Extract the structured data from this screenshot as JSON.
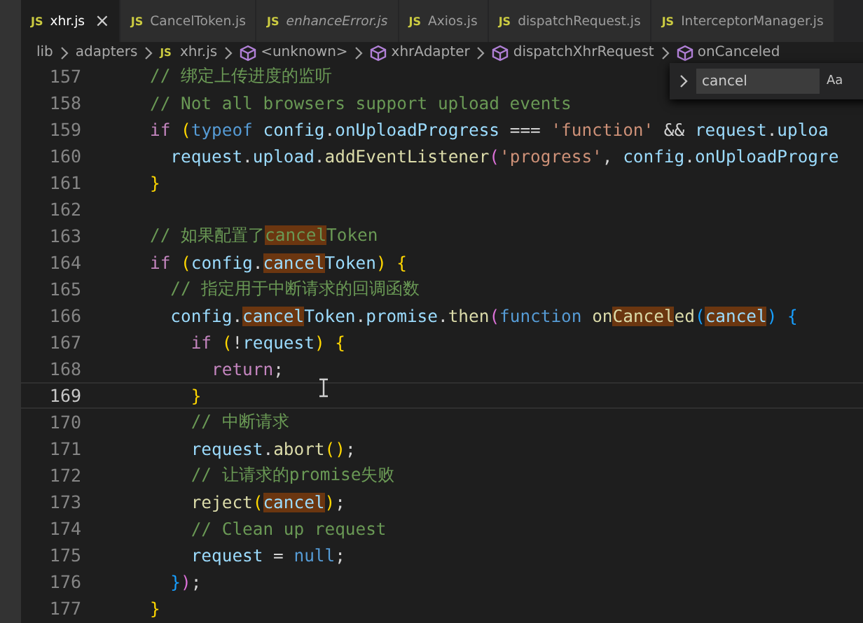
{
  "tabs": [
    {
      "icon_text": "JS",
      "label": "xhr.js",
      "selected": true,
      "preview": false,
      "close": "×"
    },
    {
      "icon_text": "JS",
      "label": "CancelToken.js",
      "selected": false,
      "preview": false
    },
    {
      "icon_text": "JS",
      "label": "enhanceError.js",
      "selected": false,
      "preview": true
    },
    {
      "icon_text": "JS",
      "label": "Axios.js",
      "selected": false,
      "preview": false
    },
    {
      "icon_text": "JS",
      "label": "dispatchRequest.js",
      "selected": false,
      "preview": false
    },
    {
      "icon_text": "JS",
      "label": "InterceptorManager.js",
      "selected": false,
      "preview": false
    }
  ],
  "breadcrumbs": [
    {
      "kind": "folder",
      "label": "lib"
    },
    {
      "kind": "folder",
      "label": "adapters"
    },
    {
      "kind": "file",
      "icon_text": "JS",
      "label": "xhr.js"
    },
    {
      "kind": "symbol",
      "label": "<unknown>"
    },
    {
      "kind": "symbol",
      "label": "xhrAdapter"
    },
    {
      "kind": "symbol",
      "label": "dispatchXhrRequest"
    },
    {
      "kind": "symbol",
      "label": "onCanceled"
    }
  ],
  "find_widget": {
    "value": "cancel",
    "case_toggle": "Aa"
  },
  "lines": [
    {
      "number": "157",
      "current": false,
      "tokens": [
        {
          "text": "// 绑定上传进度的监听",
          "kind": "comment",
          "match": false
        }
      ]
    },
    {
      "number": "158",
      "current": false,
      "tokens": [
        {
          "text": "// Not all browsers support upload events",
          "kind": "comment",
          "match": false
        }
      ]
    },
    {
      "number": "159",
      "current": false,
      "tokens": [
        {
          "text": "if ",
          "kind": "keyword",
          "match": false
        },
        {
          "text": "(",
          "kind": "bracket1",
          "match": false
        },
        {
          "text": "typeof ",
          "kind": "storage",
          "match": false
        },
        {
          "text": "config",
          "kind": "variable",
          "match": false
        },
        {
          "text": ".",
          "kind": "plain",
          "match": false
        },
        {
          "text": "onUploadProgress",
          "kind": "variable",
          "match": false
        },
        {
          "text": " === ",
          "kind": "plain",
          "match": false
        },
        {
          "text": "'function'",
          "kind": "string",
          "match": false
        },
        {
          "text": " && ",
          "kind": "plain",
          "match": false
        },
        {
          "text": "request",
          "kind": "variable",
          "match": false
        },
        {
          "text": ".",
          "kind": "plain",
          "match": false
        },
        {
          "text": "uploa",
          "kind": "variable",
          "match": false
        }
      ]
    },
    {
      "number": "160",
      "current": false,
      "tokens": [
        {
          "text": "  request",
          "kind": "variable",
          "match": false
        },
        {
          "text": ".",
          "kind": "plain",
          "match": false
        },
        {
          "text": "upload",
          "kind": "variable",
          "match": false
        },
        {
          "text": ".",
          "kind": "plain",
          "match": false
        },
        {
          "text": "addEventListener",
          "kind": "function",
          "match": false
        },
        {
          "text": "(",
          "kind": "bracket2",
          "match": false
        },
        {
          "text": "'progress'",
          "kind": "string",
          "match": false
        },
        {
          "text": ", ",
          "kind": "plain",
          "match": false
        },
        {
          "text": "config",
          "kind": "variable",
          "match": false
        },
        {
          "text": ".",
          "kind": "plain",
          "match": false
        },
        {
          "text": "onUploadProgre",
          "kind": "variable",
          "match": false
        }
      ]
    },
    {
      "number": "161",
      "current": false,
      "tokens": [
        {
          "text": "}",
          "kind": "bracket1",
          "match": false
        }
      ]
    },
    {
      "number": "162",
      "current": false
    },
    {
      "number": "163",
      "current": false,
      "tokens": [
        {
          "text": "// 如果配置了",
          "kind": "comment",
          "match": false
        },
        {
          "text": "cancel",
          "kind": "comment",
          "match": true
        },
        {
          "text": "Token",
          "kind": "comment",
          "match": false
        }
      ]
    },
    {
      "number": "164",
      "current": false,
      "tokens": [
        {
          "text": "if ",
          "kind": "keyword",
          "match": false
        },
        {
          "text": "(",
          "kind": "bracket1",
          "match": false
        },
        {
          "text": "config",
          "kind": "variable",
          "match": false
        },
        {
          "text": ".",
          "kind": "plain",
          "match": false
        },
        {
          "text": "cancel",
          "kind": "variable",
          "match": true
        },
        {
          "text": "Token",
          "kind": "variable",
          "match": false
        },
        {
          "text": ") {",
          "kind": "bracket1",
          "match": false
        }
      ]
    },
    {
      "number": "165",
      "current": false,
      "tokens": [
        {
          "text": "  // 指定用于中断请求的回调函数",
          "kind": "comment",
          "match": false
        }
      ]
    },
    {
      "number": "166",
      "current": false,
      "tokens": [
        {
          "text": "  config",
          "kind": "variable",
          "match": false
        },
        {
          "text": ".",
          "kind": "plain",
          "match": false
        },
        {
          "text": "cancel",
          "kind": "variable",
          "match": true
        },
        {
          "text": "Token",
          "kind": "variable",
          "match": false
        },
        {
          "text": ".",
          "kind": "plain",
          "match": false
        },
        {
          "text": "promise",
          "kind": "variable",
          "match": false
        },
        {
          "text": ".",
          "kind": "plain",
          "match": false
        },
        {
          "text": "then",
          "kind": "function",
          "match": false
        },
        {
          "text": "(",
          "kind": "bracket2",
          "match": false
        },
        {
          "text": "function ",
          "kind": "storage",
          "match": false
        },
        {
          "text": "on",
          "kind": "function",
          "match": false
        },
        {
          "text": "Cancel",
          "kind": "function",
          "match": true
        },
        {
          "text": "ed",
          "kind": "function",
          "match": false
        },
        {
          "text": "(",
          "kind": "bracket3",
          "match": false
        },
        {
          "text": "cancel",
          "kind": "variable",
          "match": true
        },
        {
          "text": ") {",
          "kind": "bracket3",
          "match": false
        }
      ]
    },
    {
      "number": "167",
      "current": false,
      "tokens": [
        {
          "text": "    if ",
          "kind": "keyword",
          "match": false
        },
        {
          "text": "(",
          "kind": "bracket1",
          "match": false
        },
        {
          "text": "!",
          "kind": "plain",
          "match": false
        },
        {
          "text": "request",
          "kind": "variable",
          "match": false
        },
        {
          "text": ") {",
          "kind": "bracket1",
          "match": false
        }
      ]
    },
    {
      "number": "168",
      "current": false,
      "tokens": [
        {
          "text": "      return",
          "kind": "keyword",
          "match": false
        },
        {
          "text": ";",
          "kind": "plain",
          "match": false
        }
      ]
    },
    {
      "number": "169",
      "current": true,
      "tokens": [
        {
          "text": "    }",
          "kind": "bracket1",
          "match": false
        }
      ]
    },
    {
      "number": "170",
      "current": false,
      "tokens": [
        {
          "text": "    // 中断请求",
          "kind": "comment",
          "match": false
        }
      ]
    },
    {
      "number": "171",
      "current": false,
      "tokens": [
        {
          "text": "    request",
          "kind": "variable",
          "match": false
        },
        {
          "text": ".",
          "kind": "plain",
          "match": false
        },
        {
          "text": "abort",
          "kind": "function",
          "match": false
        },
        {
          "text": "()",
          "kind": "bracket1",
          "match": false
        },
        {
          "text": ";",
          "kind": "plain",
          "match": false
        }
      ]
    },
    {
      "number": "172",
      "current": false,
      "tokens": [
        {
          "text": "    // 让请求的promise失败",
          "kind": "comment",
          "match": false
        }
      ]
    },
    {
      "number": "173",
      "current": false,
      "tokens": [
        {
          "text": "    reject",
          "kind": "function",
          "match": false
        },
        {
          "text": "(",
          "kind": "bracket1",
          "match": false
        },
        {
          "text": "cancel",
          "kind": "variable",
          "match": true
        },
        {
          "text": ")",
          "kind": "bracket1",
          "match": false
        },
        {
          "text": ";",
          "kind": "plain",
          "match": false
        }
      ]
    },
    {
      "number": "174",
      "current": false,
      "tokens": [
        {
          "text": "    // Clean up request",
          "kind": "comment",
          "match": false
        }
      ]
    },
    {
      "number": "175",
      "current": false,
      "tokens": [
        {
          "text": "    request",
          "kind": "variable",
          "match": false
        },
        {
          "text": " = ",
          "kind": "plain",
          "match": false
        },
        {
          "text": "null",
          "kind": "storage",
          "match": false
        },
        {
          "text": ";",
          "kind": "plain",
          "match": false
        }
      ]
    },
    {
      "number": "176",
      "current": false,
      "tokens": [
        {
          "text": "  }",
          "kind": "bracket3",
          "match": false
        },
        {
          "text": ")",
          "kind": "bracket2",
          "match": false
        },
        {
          "text": ";",
          "kind": "plain",
          "match": false
        }
      ]
    },
    {
      "number": "177",
      "current": false,
      "tokens": [
        {
          "text": "}",
          "kind": "bracket1",
          "match": false
        }
      ]
    }
  ]
}
